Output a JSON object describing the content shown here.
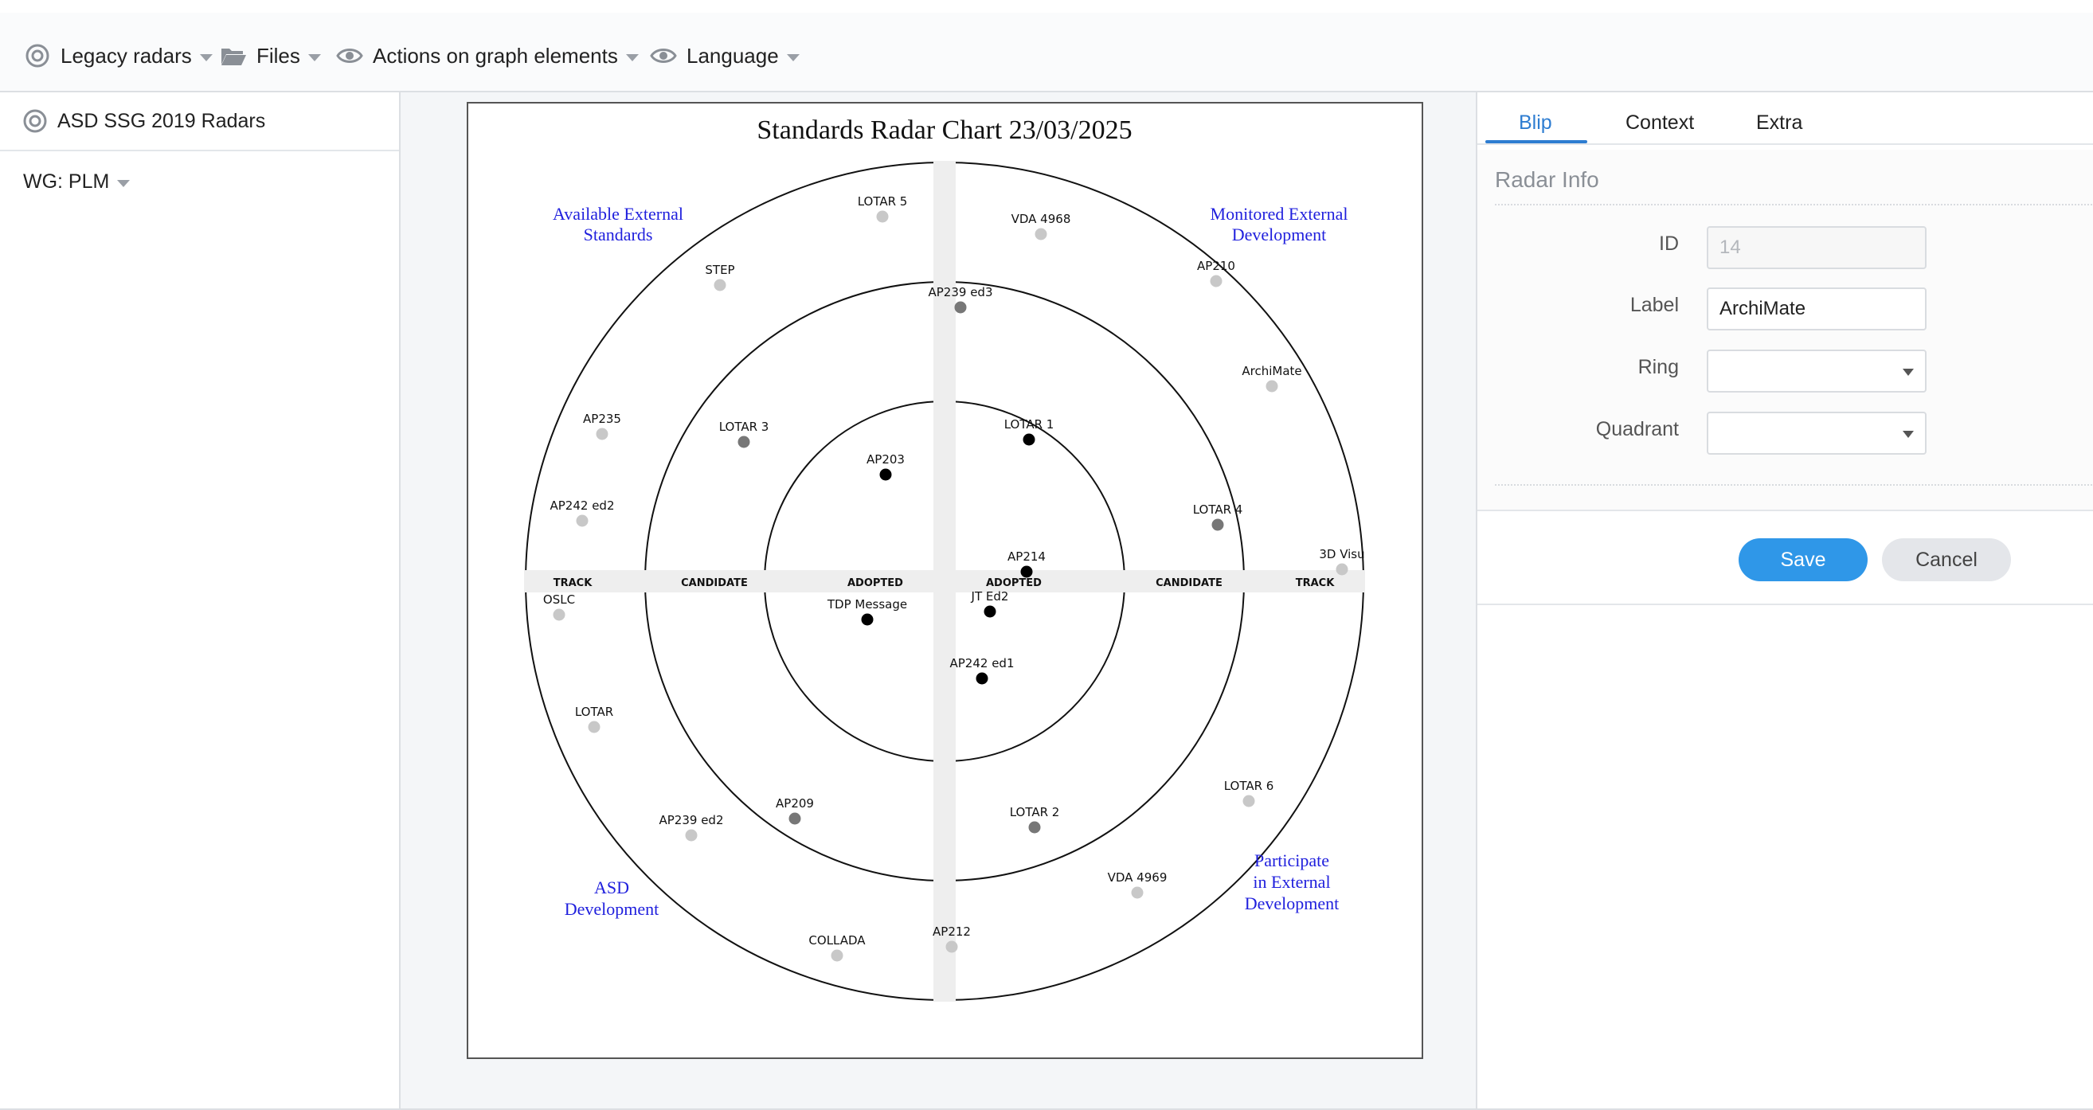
{
  "menubar": {
    "items": [
      {
        "label": "Legacy radars",
        "icon": "target-icon"
      },
      {
        "label": "Files",
        "icon": "folder-icon"
      },
      {
        "label": "Actions on graph elements",
        "icon": "eye-icon"
      },
      {
        "label": "Language",
        "icon": "eye-icon"
      }
    ]
  },
  "sidebar": {
    "radar_set": "ASD SSG 2019 Radars",
    "wg_select": "WG: PLM"
  },
  "chart_data": {
    "type": "radar",
    "title": "Standards Radar Chart 23/03/2025",
    "quadrants": [
      "Available External Standards",
      "Monitored External Development",
      "ASD Development",
      "Participate in External Development"
    ],
    "rings_left": [
      "TRACK",
      "CANDIDATE",
      "ADOPTED"
    ],
    "rings_right": [
      "ADOPTED",
      "CANDIDATE",
      "TRACK"
    ],
    "blips": [
      {
        "label": "LOTAR 5",
        "quadrant": "Available External Standards",
        "ring": "TRACK"
      },
      {
        "label": "STEP",
        "quadrant": "Available External Standards",
        "ring": "TRACK"
      },
      {
        "label": "AP235",
        "quadrant": "Available External Standards",
        "ring": "TRACK"
      },
      {
        "label": "AP242 ed2",
        "quadrant": "Available External Standards",
        "ring": "TRACK"
      },
      {
        "label": "LOTAR 3",
        "quadrant": "Available External Standards",
        "ring": "CANDIDATE"
      },
      {
        "label": "AP203",
        "quadrant": "Available External Standards",
        "ring": "ADOPTED"
      },
      {
        "label": "VDA 4968",
        "quadrant": "Monitored External Development",
        "ring": "TRACK"
      },
      {
        "label": "AP210",
        "quadrant": "Monitored External Development",
        "ring": "TRACK"
      },
      {
        "label": "ArchiMate",
        "quadrant": "Monitored External Development",
        "ring": "TRACK"
      },
      {
        "label": "3D Visu",
        "quadrant": "Monitored External Development",
        "ring": "TRACK"
      },
      {
        "label": "AP239 ed3",
        "quadrant": "Monitored External Development",
        "ring": "CANDIDATE"
      },
      {
        "label": "LOTAR 4",
        "quadrant": "Monitored External Development",
        "ring": "CANDIDATE"
      },
      {
        "label": "LOTAR 1",
        "quadrant": "Monitored External Development",
        "ring": "ADOPTED"
      },
      {
        "label": "AP214",
        "quadrant": "Monitored External Development",
        "ring": "ADOPTED"
      },
      {
        "label": "OSLC",
        "quadrant": "ASD Development",
        "ring": "TRACK"
      },
      {
        "label": "LOTAR",
        "quadrant": "ASD Development",
        "ring": "TRACK"
      },
      {
        "label": "AP239 ed2",
        "quadrant": "ASD Development",
        "ring": "TRACK"
      },
      {
        "label": "COLLADA",
        "quadrant": "ASD Development",
        "ring": "TRACK"
      },
      {
        "label": "AP209",
        "quadrant": "ASD Development",
        "ring": "CANDIDATE"
      },
      {
        "label": "TDP Message",
        "quadrant": "ASD Development",
        "ring": "ADOPTED"
      },
      {
        "label": "JT Ed2",
        "quadrant": "Participate in External Development",
        "ring": "ADOPTED"
      },
      {
        "label": "AP242 ed1",
        "quadrant": "Participate in External Development",
        "ring": "ADOPTED"
      },
      {
        "label": "LOTAR 2",
        "quadrant": "Participate in External Development",
        "ring": "CANDIDATE"
      },
      {
        "label": "AP212",
        "quadrant": "Participate in External Development",
        "ring": "TRACK"
      },
      {
        "label": "VDA 4969",
        "quadrant": "Participate in External Development",
        "ring": "TRACK"
      },
      {
        "label": "LOTAR 6",
        "quadrant": "Participate in External Development",
        "ring": "TRACK"
      }
    ],
    "ring_colors": {
      "ADOPTED": "#000000",
      "CANDIDATE": "#777777",
      "TRACK": "#c8c8c8"
    }
  },
  "panel": {
    "tabs": [
      "Blip",
      "Context",
      "Extra"
    ],
    "active_tab": "Blip",
    "section_title": "Radar Info",
    "fields": {
      "id_label": "ID",
      "id_value": "14",
      "label_label": "Label",
      "label_value": "ArchiMate",
      "ring_label": "Ring",
      "ring_value": "",
      "quadrant_label": "Quadrant",
      "quadrant_value": ""
    },
    "save_label": "Save",
    "cancel_label": "Cancel",
    "accent_color": "#2e7dd1"
  }
}
